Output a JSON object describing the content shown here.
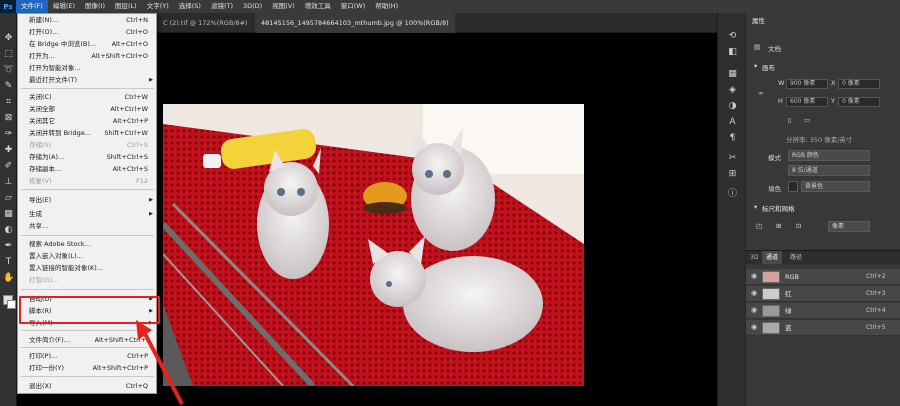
{
  "menubar": {
    "items": [
      "文件(F)",
      "编辑(E)",
      "图像(I)",
      "图层(L)",
      "文字(Y)",
      "选择(S)",
      "滤镜(T)",
      "3D(D)",
      "视图(V)",
      "增效工具",
      "窗口(W)",
      "帮助(H)"
    ]
  },
  "tabs": [
    {
      "label": "C (2).tif @ 172%(RGB/8#)"
    },
    {
      "label": "48145156_1495784664103_mthumb.jpg @ 100%(RGB/8)"
    }
  ],
  "menu": {
    "items": [
      {
        "label": "新建(N)...",
        "shortcut": "Ctrl+N"
      },
      {
        "label": "打开(O)...",
        "shortcut": "Ctrl+O"
      },
      {
        "label": "在 Bridge 中浏览(B)...",
        "shortcut": "Alt+Ctrl+O"
      },
      {
        "label": "打开为...",
        "shortcut": "Alt+Shift+Ctrl+O"
      },
      {
        "label": "打开为智能对象...",
        "shortcut": ""
      },
      {
        "label": "最近打开文件(T)",
        "shortcut": ""
      },
      {
        "label": "关闭(C)",
        "shortcut": "Ctrl+W"
      },
      {
        "label": "关闭全部",
        "shortcut": "Alt+Ctrl+W"
      },
      {
        "label": "关闭其它",
        "shortcut": "Alt+Ctrl+P"
      },
      {
        "label": "关闭并转到 Bridge...",
        "shortcut": "Shift+Ctrl+W"
      },
      {
        "label": "存储(S)",
        "shortcut": "Ctrl+S"
      },
      {
        "label": "存储为(A)...",
        "shortcut": "Shift+Ctrl+S"
      },
      {
        "label": "存储副本...",
        "shortcut": "Alt+Ctrl+S"
      },
      {
        "label": "恢复(V)",
        "shortcut": "F12"
      },
      {
        "label": "导出(E)",
        "shortcut": ""
      },
      {
        "label": "生成",
        "shortcut": ""
      },
      {
        "label": "共享...",
        "shortcut": ""
      },
      {
        "label": "搜索 Adobe Stock...",
        "shortcut": ""
      },
      {
        "label": "置入嵌入对象(L)...",
        "shortcut": ""
      },
      {
        "label": "置入链接的智能对象(K)...",
        "shortcut": ""
      },
      {
        "label": "打包(G)...",
        "shortcut": ""
      },
      {
        "label": "自动(U)",
        "shortcut": ""
      },
      {
        "label": "脚本(R)",
        "shortcut": ""
      },
      {
        "label": "导入(M)",
        "shortcut": ""
      },
      {
        "label": "文件简介(F)...",
        "shortcut": "Alt+Shift+Ctrl+I"
      },
      {
        "label": "打印(P)...",
        "shortcut": "Ctrl+P"
      },
      {
        "label": "打印一份(Y)",
        "shortcut": "Alt+Shift+Ctrl+P"
      },
      {
        "label": "退出(X)",
        "shortcut": "Ctrl+Q"
      }
    ]
  },
  "props": {
    "title": "属性",
    "doc_label": "文档",
    "canvas_header": "画布",
    "w_label": "W",
    "w_value": "900 像素",
    "h_label": "H",
    "h_value": "600 像素",
    "x_label": "X",
    "x_value": "0 像素",
    "y_label": "Y",
    "y_value": "0 像素",
    "resolution": "分辨率: 350 像素/英寸",
    "mode_label": "模式",
    "mode_value": "RGB 颜色",
    "depth_value": "8 位/通道",
    "fill_label": "填色",
    "fill_value": "背景色",
    "rulers_header": "标尺和网格",
    "units_value": "像素"
  },
  "channels": {
    "tabs": [
      "3D",
      "通道",
      "路径"
    ],
    "rows": [
      {
        "name": "RGB",
        "shortcut": "Ctrl+2"
      },
      {
        "name": "红",
        "shortcut": "Ctrl+3"
      },
      {
        "name": "绿",
        "shortcut": "Ctrl+4"
      },
      {
        "name": "蓝",
        "shortcut": "Ctrl+5"
      }
    ]
  },
  "colors": {
    "menu_active": "#1f66c2",
    "highlight": "#e4231f",
    "canvas_bg": "#000000",
    "mesh_red": "#e3262e"
  },
  "photo": {
    "subject": "three kittens on red mesh"
  }
}
